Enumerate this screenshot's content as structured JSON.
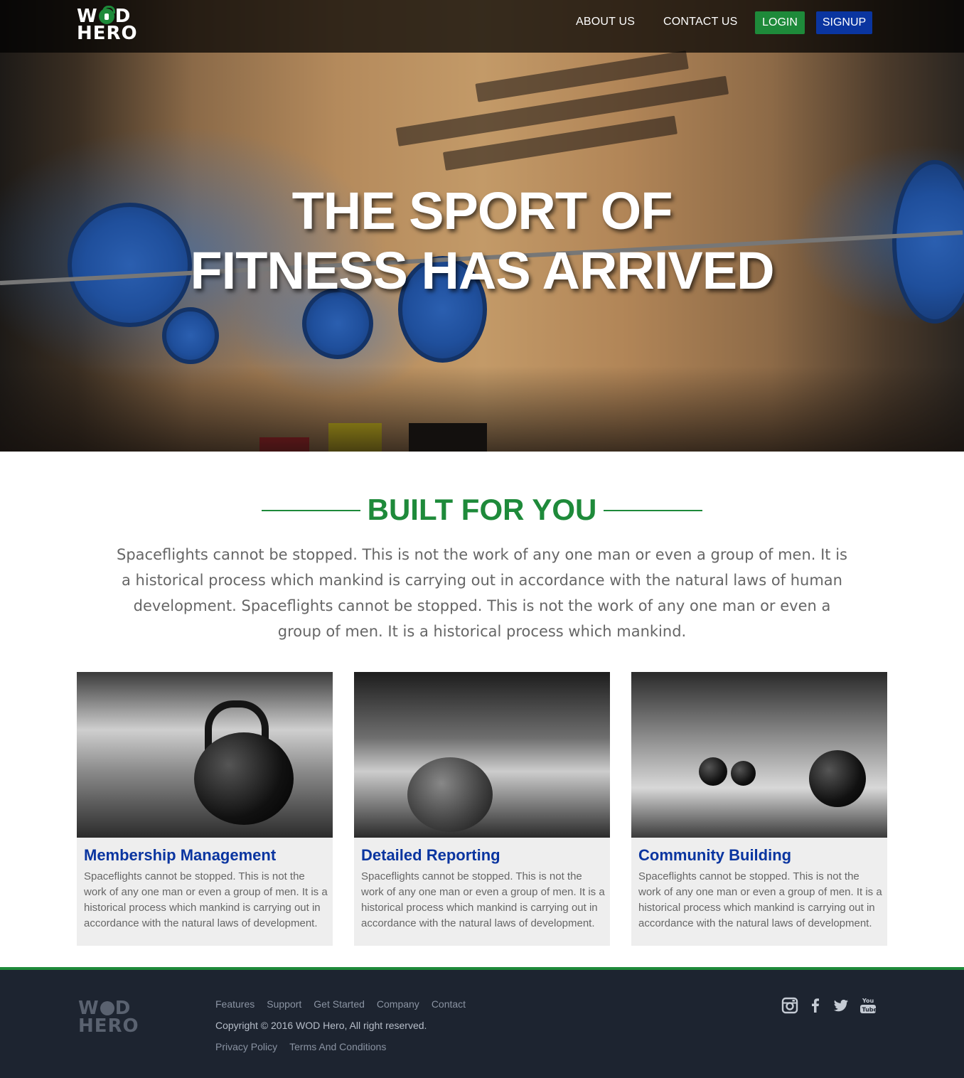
{
  "nav": {
    "logo_line1_a": "W",
    "logo_line1_b": "D",
    "logo_line2": "HERO",
    "about": "ABOUT US",
    "contact": "CONTACT US",
    "login": "LOGIN",
    "signup": "SIGNUP"
  },
  "hero": {
    "title_line1": "THE SPORT OF",
    "title_line2": "FITNESS HAS ARRIVED"
  },
  "section": {
    "heading": "BUILT FOR YOU",
    "intro": "Spaceflights cannot be stopped. This is not the work of any one man or even a group of men. It is a historical process which mankind is carrying out in accordance with the natural laws of human development. Spaceflights cannot be stopped. This is not the work of any one man or even a group of men. It is a historical process which mankind."
  },
  "cards": [
    {
      "title": "Membership Management",
      "text": "Spaceflights cannot be stopped. This is not the work of any one man or even a group of men. It is a historical process which mankind is carrying out in accordance with the natural laws of development."
    },
    {
      "title": "Detailed Reporting",
      "text": "Spaceflights cannot be stopped. This is not the work of any one man or even a group of men. It is a historical process which mankind is carrying out in accordance with the natural laws of development."
    },
    {
      "title": "Community Building",
      "text": "Spaceflights cannot be stopped. This is not the work of any one man or even a group of men. It is a historical process which mankind is carrying out in accordance with the natural laws of development."
    }
  ],
  "footer": {
    "logo_line1_a": "W",
    "logo_line1_b": "D",
    "logo_line2": "HERO",
    "links": [
      "Features",
      "Support",
      "Get Started",
      "Company",
      "Contact"
    ],
    "copyright": "Copyright © 2016 WOD Hero, All right reserved.",
    "legal": [
      "Privacy Policy",
      "Terms And Conditions"
    ],
    "social": [
      "instagram-icon",
      "facebook-icon",
      "twitter-icon",
      "youtube-icon"
    ]
  },
  "colors": {
    "green": "#1e8a3a",
    "blue": "#0a35a0",
    "footer_bg": "#1d2430"
  }
}
